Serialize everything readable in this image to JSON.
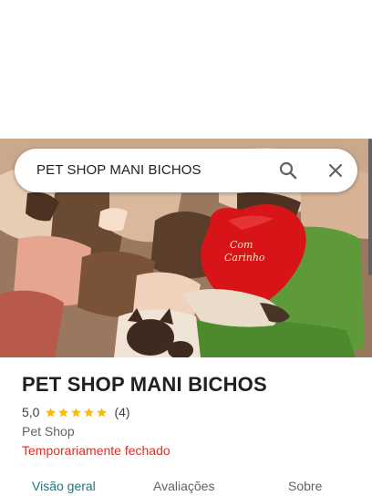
{
  "search": {
    "query": "PET SHOP MANI BICHOS"
  },
  "place": {
    "name": "PET SHOP MANI BICHOS",
    "rating": "5,0",
    "stars": 5,
    "review_count": "(4)",
    "category": "Pet Shop",
    "status": "Temporariamente fechado"
  },
  "photo": {
    "pillow_text_line1": "Com",
    "pillow_text_line2": "Carinho"
  },
  "tabs": [
    {
      "label": "Visão geral",
      "active": true
    },
    {
      "label": "Avaliações",
      "active": false
    },
    {
      "label": "Sobre",
      "active": false
    }
  ],
  "colors": {
    "accent": "#137a7f",
    "closed": "#d93025",
    "star": "#fbbc04"
  }
}
